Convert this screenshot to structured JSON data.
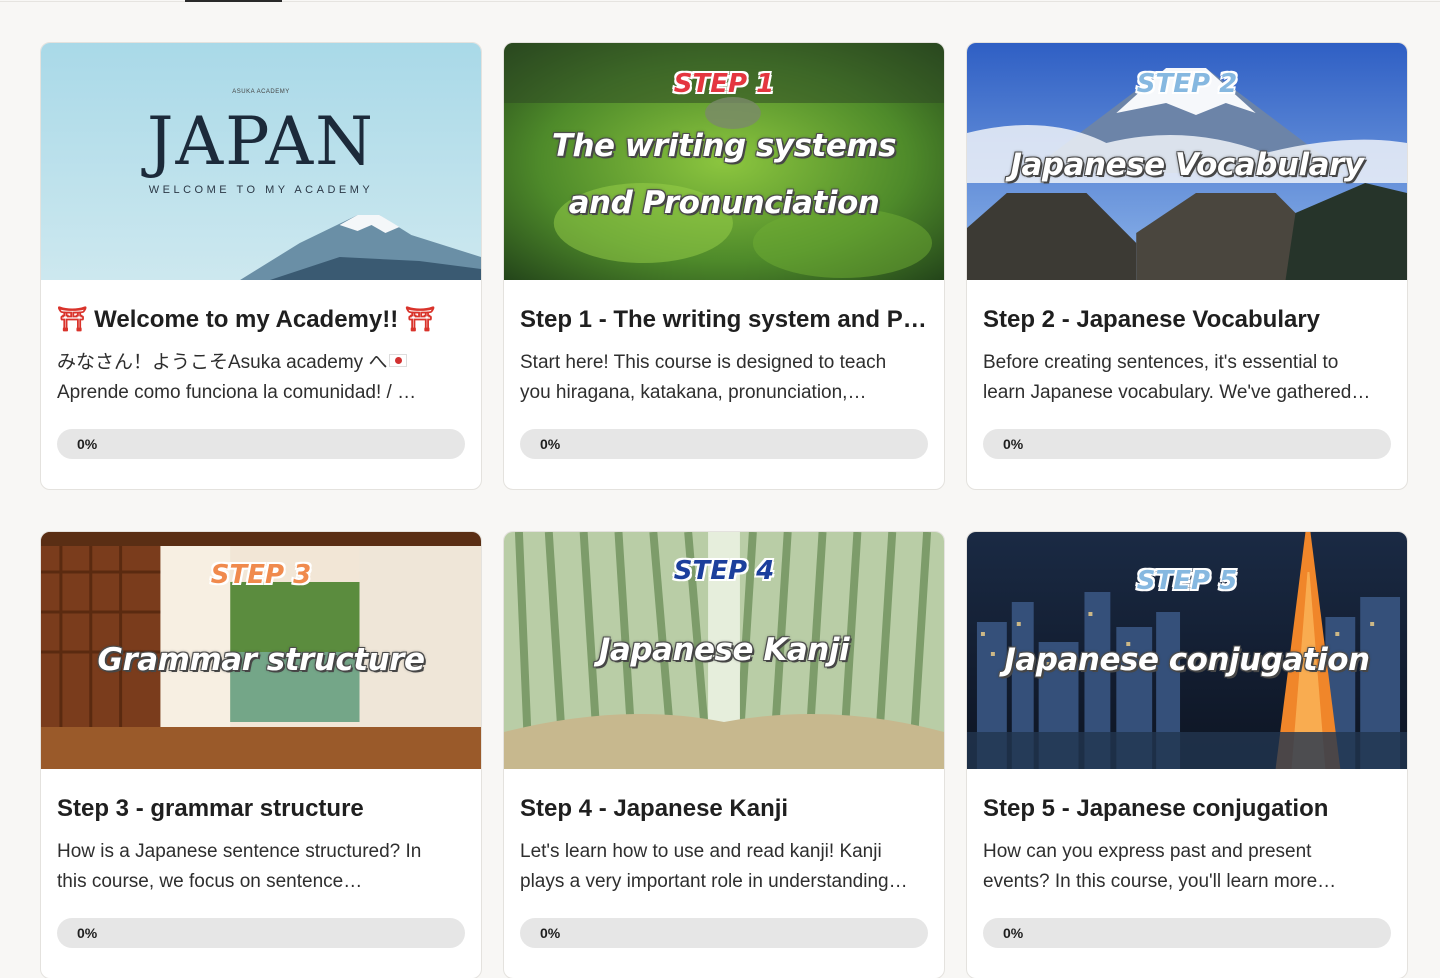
{
  "courses": [
    {
      "banner": {
        "small_text": "ASUKA ACADEMY",
        "big_text": "JAPAN",
        "sub_text": "WELCOME TO MY ACADEMY"
      },
      "title_icon": "⛩",
      "title": "Welcome to my Academy!!",
      "desc_line1": "みなさん！ようこそAsuka academy へ",
      "desc_line2": "Aprende como funciona la comunidad! / …",
      "progress": "0%",
      "progress_value": 0
    },
    {
      "banner": {
        "step": "STEP 1",
        "headline": "The writing systems and Pronunciation"
      },
      "title": "Step 1 - The writing system and P…",
      "desc_line1": "Start here! This course is designed to teach",
      "desc_line2": "you hiragana, katakana, pronunciation,…",
      "progress": "0%",
      "progress_value": 0
    },
    {
      "banner": {
        "step": "STEP 2",
        "headline": "Japanese Vocabulary"
      },
      "title": "Step 2 - Japanese Vocabulary",
      "desc_line1": "Before creating sentences, it's essential to",
      "desc_line2": "learn Japanese vocabulary. We've gathered…",
      "progress": "0%",
      "progress_value": 0
    },
    {
      "banner": {
        "step": "STEP 3",
        "headline": "Grammar structure"
      },
      "title": "Step 3 - grammar structure",
      "desc_line1": "How is a Japanese sentence structured? In",
      "desc_line2": "this course, we focus on sentence…",
      "progress": "0%",
      "progress_value": 0
    },
    {
      "banner": {
        "step": "STEP 4",
        "headline": "Japanese Kanji"
      },
      "title": "Step 4 - Japanese Kanji",
      "desc_line1": "Let's learn how to use and read kanji! Kanji",
      "desc_line2": "plays a very important role in understanding…",
      "progress": "0%",
      "progress_value": 0
    },
    {
      "banner": {
        "step": "STEP 5",
        "headline": "Japanese conjugation"
      },
      "title": "Step 5 - Japanese conjugation",
      "desc_line1": "How can you express past and present",
      "desc_line2": "events? In this course, you'll learn more…",
      "progress": "0%",
      "progress_value": 0
    }
  ],
  "colors": {
    "page_background": "#f8f7f5",
    "card_background": "#ffffff",
    "progress_track": "#e6e6e6",
    "step1_label": "#e4363f",
    "step2_label": "#5fb6f0",
    "step3_label": "#f08a4d",
    "step4_label": "#1c3f9c",
    "step5_label": "#86b8e0"
  }
}
